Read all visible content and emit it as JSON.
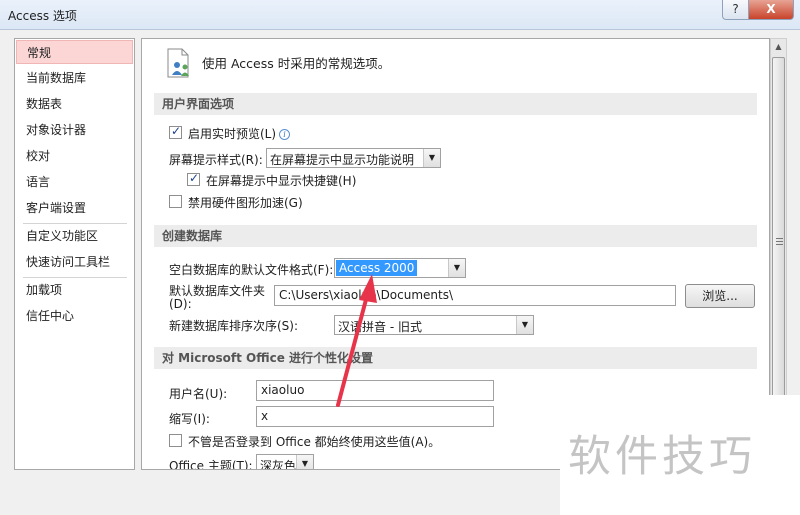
{
  "window": {
    "title": "Access 选项",
    "help_label": "?",
    "close_label": "X"
  },
  "nav": {
    "items": [
      {
        "label": "常规"
      },
      {
        "label": "当前数据库"
      },
      {
        "label": "数据表"
      },
      {
        "label": "对象设计器"
      },
      {
        "label": "校对"
      },
      {
        "label": "语言"
      },
      {
        "label": "客户端设置"
      },
      {
        "label": "自定义功能区"
      },
      {
        "label": "快速访问工具栏"
      },
      {
        "label": "加载项"
      },
      {
        "label": "信任中心"
      }
    ],
    "selected": "常规"
  },
  "intro": {
    "text": "使用 Access 时采用的常规选项。",
    "icon": "people-settings-icon"
  },
  "ui_section": {
    "header": "用户界面选项",
    "live_preview": {
      "label": "启用实时预览(L)",
      "checked": true,
      "icon": "info-icon"
    },
    "screentip_label": "屏幕提示样式(R):",
    "screentip_value": "在屏幕提示中显示功能说明",
    "shortcut_keys": {
      "label": "在屏幕提示中显示快捷键(H)",
      "checked": true
    },
    "disable_hw": {
      "label": "禁用硬件图形加速(G)",
      "checked": false
    }
  },
  "create_section": {
    "header": "创建数据库",
    "format_label": "空白数据库的默认文件格式(F):",
    "format_value": "Access 2000",
    "folder_label_line1": "默认数据库文件夹",
    "folder_label_line2": "(D):",
    "folder_value": "C:\\Users\\xiaoluo\\Documents\\",
    "browse_label": "浏览...",
    "sort_label": "新建数据库排序次序(S):",
    "sort_value": "汉语拼音 - 旧式"
  },
  "personal_section": {
    "header": "对 Microsoft Office 进行个性化设置",
    "username_label": "用户名(U):",
    "username_value": "xiaoluo",
    "initials_label": "缩写(I):",
    "initials_value": "x",
    "always_use": {
      "label": "不管是否登录到 Office 都始终使用这些值(A)。",
      "checked": false
    },
    "theme_label": "Office 主题(T):",
    "theme_value": "深灰色"
  },
  "watermark": {
    "text": "软件技巧"
  },
  "colors": {
    "annotation_arrow": "#e8344a",
    "nav_selected": "#fcd5d5",
    "selection_blue": "#3399ff"
  }
}
